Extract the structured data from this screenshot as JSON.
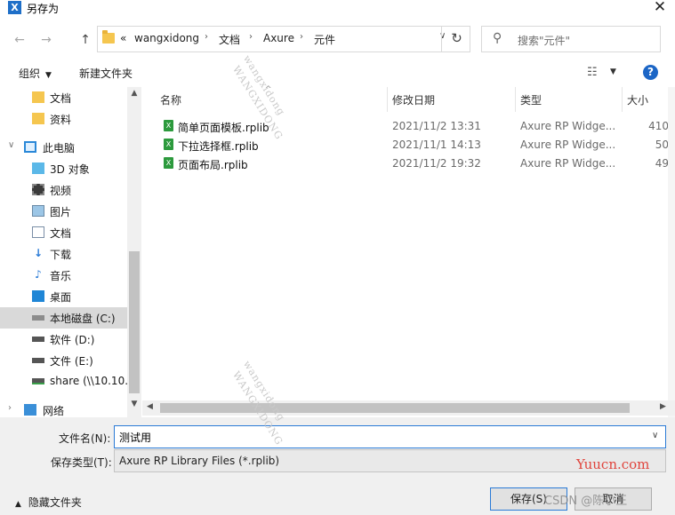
{
  "window": {
    "title": "另存为",
    "app_icon_letter": "X",
    "close_glyph": "✕"
  },
  "nav_buttons": {
    "back": "←",
    "forward": "→",
    "up": "↑"
  },
  "address": {
    "prefix": "«",
    "breadcrumbs": [
      "wangxidong",
      "文档",
      "Axure",
      "元件"
    ],
    "separator": "›",
    "dropdown": "∨",
    "refresh": "↻"
  },
  "search": {
    "placeholder": "搜索\"元件\"",
    "icon": "⚲"
  },
  "toolbar": {
    "organize": "组织",
    "new_folder": "新建文件夹",
    "view_icon": "☷",
    "help": "?"
  },
  "nav_pane": {
    "items": [
      {
        "label": "文档",
        "icon": "folder-icon"
      },
      {
        "label": "资料",
        "icon": "folder-icon"
      },
      {
        "label": "此电脑",
        "icon": "computer-icon"
      },
      {
        "label": "3D 对象",
        "icon": "cube-icon"
      },
      {
        "label": "视频",
        "icon": "video-icon"
      },
      {
        "label": "图片",
        "icon": "picture-icon"
      },
      {
        "label": "文档",
        "icon": "document-icon"
      },
      {
        "label": "下载",
        "icon": "download-icon"
      },
      {
        "label": "音乐",
        "icon": "music-icon"
      },
      {
        "label": "桌面",
        "icon": "desktop-icon"
      },
      {
        "label": "本地磁盘 (C:)",
        "icon": "drive-icon",
        "selected": true
      },
      {
        "label": "软件 (D:)",
        "icon": "drive-icon"
      },
      {
        "label": "文件 (E:)",
        "icon": "drive-icon"
      },
      {
        "label": "share (\\\\10.10.",
        "icon": "network-drive-icon"
      },
      {
        "label": "网络",
        "icon": "network-icon"
      }
    ]
  },
  "file_list": {
    "columns": [
      "名称",
      "修改日期",
      "类型",
      "大小"
    ],
    "rows": [
      {
        "name": "简单页面模板.rplib",
        "date": "2021/11/2 13:31",
        "type": "Axure RP Widge...",
        "size": "410"
      },
      {
        "name": "下拉选择框.rplib",
        "date": "2021/11/1 14:13",
        "type": "Axure RP Widge...",
        "size": "50"
      },
      {
        "name": "页面布局.rplib",
        "date": "2021/11/2 19:32",
        "type": "Axure RP Widge...",
        "size": "49"
      }
    ]
  },
  "form": {
    "filename_label": "文件名(N):",
    "filename_value": "测试用",
    "filetype_label": "保存类型(T):",
    "filetype_value": "Axure RP Library Files (*.rplib)"
  },
  "footer": {
    "hide_folders": "隐藏文件夹",
    "save": "保存(S)",
    "cancel": "取消"
  },
  "watermarks": {
    "diag_1": "wangxidong",
    "diag_2": "WANGXIDONG",
    "yuucn": "Yuucn.com",
    "csdn": "CSDN @陈小王"
  },
  "colors": {
    "accent": "#2a7ad6",
    "help_blue": "#1c66c6",
    "file_icon_green": "#2c9a3d",
    "selected_nav": "#d9d9d9"
  }
}
